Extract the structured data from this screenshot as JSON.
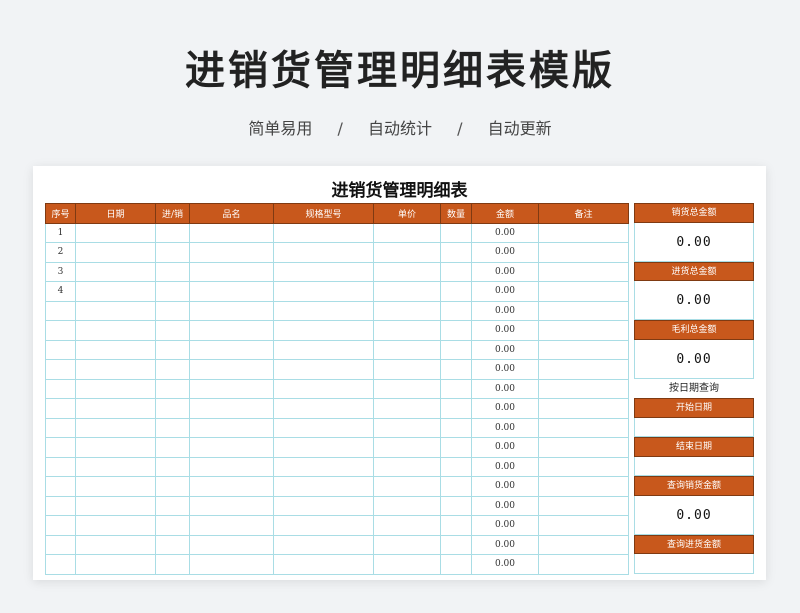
{
  "page": {
    "title": "进销货管理明细表模版",
    "tagline": [
      "简单易用",
      "自动统计",
      "自动更新"
    ],
    "tagline_separator": "/"
  },
  "sheet": {
    "title": "进销货管理明细表",
    "columns": [
      "序号",
      "日期",
      "进/销",
      "品名",
      "规格型号",
      "单价",
      "数量",
      "金额",
      "备注"
    ],
    "rows": [
      {
        "no": "1",
        "amount": "0.00"
      },
      {
        "no": "2",
        "amount": "0.00"
      },
      {
        "no": "3",
        "amount": "0.00"
      },
      {
        "no": "4",
        "amount": "0.00"
      },
      {
        "no": "",
        "amount": "0.00"
      },
      {
        "no": "",
        "amount": "0.00"
      },
      {
        "no": "",
        "amount": "0.00"
      },
      {
        "no": "",
        "amount": "0.00"
      },
      {
        "no": "",
        "amount": "0.00"
      },
      {
        "no": "",
        "amount": "0.00"
      },
      {
        "no": "",
        "amount": "0.00"
      },
      {
        "no": "",
        "amount": "0.00"
      },
      {
        "no": "",
        "amount": "0.00"
      },
      {
        "no": "",
        "amount": "0.00"
      },
      {
        "no": "",
        "amount": "0.00"
      },
      {
        "no": "",
        "amount": "0.00"
      },
      {
        "no": "",
        "amount": "0.00"
      },
      {
        "no": "",
        "amount": "0.00"
      }
    ]
  },
  "summary": {
    "sales_total_label": "销货总金额",
    "sales_total_value": "0.00",
    "purchase_total_label": "进货总金额",
    "purchase_total_value": "0.00",
    "gross_profit_label": "毛利总金额",
    "gross_profit_value": "0.00",
    "query_by_date_label": "按日期查询",
    "start_date_label": "开始日期",
    "end_date_label": "结束日期",
    "query_sales_label": "查询销货金额",
    "query_sales_value": "0.00",
    "query_purchase_label": "查询进货金额"
  },
  "colors": {
    "header_bg": "#c8581c",
    "grid_line": "#a9dde5",
    "page_bg": "#f1f3f5"
  }
}
